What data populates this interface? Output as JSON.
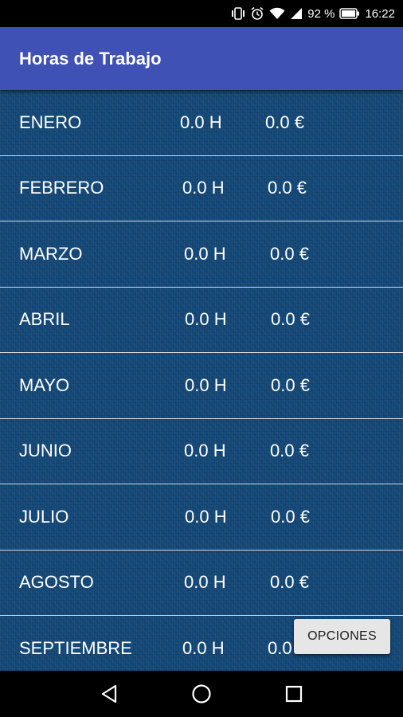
{
  "status_bar": {
    "battery": "92 %",
    "time": "16:22",
    "icons": [
      "vibrate-icon",
      "alarm-icon",
      "wifi-icon",
      "signal-icon",
      "battery-icon"
    ]
  },
  "app_bar": {
    "title": "Horas de Trabajo",
    "color": "#3f51b5"
  },
  "months": [
    {
      "name": "ENERO",
      "hours": "0.0 H",
      "money": "0.0 €"
    },
    {
      "name": "FEBRERO",
      "hours": "0.0 H",
      "money": "0.0 €"
    },
    {
      "name": "MARZO",
      "hours": "0.0 H",
      "money": "0.0 €"
    },
    {
      "name": "ABRIL",
      "hours": "0.0 H",
      "money": "0.0 €"
    },
    {
      "name": "MAYO",
      "hours": "0.0 H",
      "money": "0.0 €"
    },
    {
      "name": "JUNIO",
      "hours": "0.0 H",
      "money": "0.0 €"
    },
    {
      "name": "JULIO",
      "hours": "0.0 H",
      "money": "0.0 €"
    },
    {
      "name": "AGOSTO",
      "hours": "0.0 H",
      "money": "0.0 €"
    },
    {
      "name": "SEPTIEMBRE",
      "hours": "0.0 H",
      "money": "0.0 €"
    }
  ],
  "options_button": {
    "label": "OPCIONES"
  },
  "nav_bar": {
    "icons": [
      "back-icon",
      "home-icon",
      "recents-icon"
    ]
  },
  "colors": {
    "background": "#134776",
    "divider": "#cfd8e6"
  }
}
